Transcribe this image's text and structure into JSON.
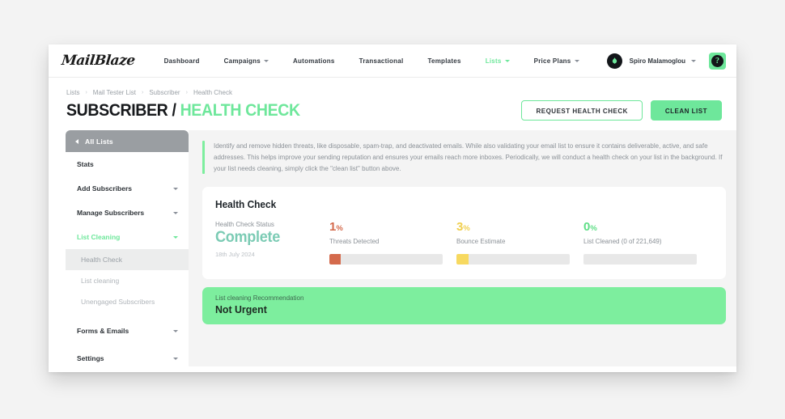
{
  "brand": {
    "logo_text": "MailBlaze",
    "accent_green": "#6ee79b",
    "banner_green": "#7dee9e"
  },
  "topnav": {
    "items": [
      {
        "label": "Dashboard",
        "has_chevron": false,
        "active": false
      },
      {
        "label": "Campaigns",
        "has_chevron": true,
        "active": false
      },
      {
        "label": "Automations",
        "has_chevron": false,
        "active": false
      },
      {
        "label": "Transactional",
        "has_chevron": false,
        "active": false
      },
      {
        "label": "Templates",
        "has_chevron": false,
        "active": false
      },
      {
        "label": "Lists",
        "has_chevron": true,
        "active": true
      },
      {
        "label": "Price Plans",
        "has_chevron": true,
        "active": false
      }
    ],
    "user_name": "Spiro Malamoglou",
    "avatar_icon": "hand-flame-icon",
    "help_label": "?"
  },
  "breadcrumb": {
    "separator": "›",
    "items": [
      "Lists",
      "Mail Tester List",
      "Subscriber",
      "Health Check"
    ]
  },
  "header": {
    "title_primary": "SUBSCRIBER /",
    "title_accent": "HEALTH CHECK",
    "request_button": "REQUEST HEALTH CHECK",
    "clean_button": "CLEAN LIST"
  },
  "sidebar": {
    "head_label": "All Lists",
    "items": [
      {
        "label": "Stats",
        "chevron": false,
        "active": false
      },
      {
        "label": "Add Subscribers",
        "chevron": true,
        "active": false
      },
      {
        "label": "Manage Subscribers",
        "chevron": true,
        "active": false
      },
      {
        "label": "List Cleaning",
        "chevron": true,
        "active": true
      }
    ],
    "sub_items": [
      {
        "label": "Health Check",
        "selected": true
      },
      {
        "label": "List cleaning",
        "selected": false
      },
      {
        "label": "Unengaged Subscribers",
        "selected": false
      }
    ],
    "bottom_items": [
      {
        "label": "Forms & Emails",
        "chevron": true
      },
      {
        "label": "Settings",
        "chevron": true
      }
    ]
  },
  "info": {
    "text": "Identify and remove hidden threats, like disposable, spam-trap, and deactivated emails. While also validating your email list to ensure it contains deliverable, active, and safe addresses. This helps improve your sending reputation and ensures your emails reach more inboxes. Periodically, we will conduct a health check on your list in the background. If your list needs cleaning, simply click the \"clean list\" button above."
  },
  "health_card": {
    "title": "Health Check",
    "status_label": "Health Check Status",
    "status_value": "Complete",
    "status_date": "18th July 2024",
    "metrics": [
      {
        "value": "1",
        "unit": "%",
        "label": "Threats Detected",
        "percent": 10,
        "color": "#d46a4c",
        "track": "#e8e8e8"
      },
      {
        "value": "3",
        "unit": "%",
        "label": "Bounce Estimate",
        "percent": 11,
        "color": "#f7d960",
        "track": "#e8e8e8"
      },
      {
        "value": "0",
        "unit": "%",
        "label": "List Cleaned (0 of 221,649)",
        "percent": 0,
        "color": "#5ede86",
        "track": "#e8e8e8"
      }
    ]
  },
  "recommendation": {
    "label": "List cleaning Recommendation",
    "value": "Not Urgent"
  }
}
